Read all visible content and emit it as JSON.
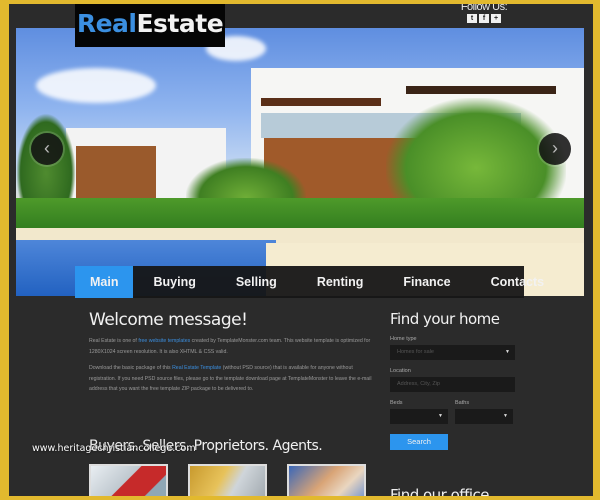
{
  "brand": {
    "part1": "Real",
    "part2": "Estate"
  },
  "social": {
    "label": "Follow Us:",
    "icons": [
      {
        "name": "twitter-icon",
        "glyph": "t"
      },
      {
        "name": "facebook-icon",
        "glyph": "f"
      },
      {
        "name": "plus-icon",
        "glyph": "+"
      }
    ]
  },
  "slider": {
    "prev": "‹",
    "next": "›"
  },
  "nav": {
    "items": [
      {
        "label": "Main",
        "active": true
      },
      {
        "label": "Buying",
        "active": false
      },
      {
        "label": "Selling",
        "active": false
      },
      {
        "label": "Renting",
        "active": false
      },
      {
        "label": "Finance",
        "active": false
      },
      {
        "label": "Contacts",
        "active": false
      }
    ]
  },
  "welcome": {
    "title": "Welcome message!",
    "p1_before": "Real Estate is one of ",
    "p1_link": "free website templates",
    "p1_after": " created by TemplateMonster.com team. This website template is optimized for 1280X1024 screen resolution. It is also XHTML & CSS valid.",
    "p2_before": "Download the basic package of this ",
    "p2_link": "Real Estate Template",
    "p2_after": " (without PSD source) that is available for anyone without registration. If you need PSD source files, please go to the template download page at TemplateMonster to leave the e-mail address that you want the free template ZIP package to be delivered to."
  },
  "section2": {
    "title": "Buyers. Sellers. Proprietors. Agents."
  },
  "watermark": "www.heritagechristiancollege.com",
  "search": {
    "title": "Find your home",
    "home_type_label": "Home type",
    "home_type_value": "Homes for sale",
    "location_label": "Location",
    "location_placeholder": "Address, City, Zip",
    "beds_label": "Beds",
    "baths_label": "Baths",
    "button": "Search"
  },
  "office": {
    "title": "Find our office"
  },
  "colors": {
    "accent": "#2c95ee",
    "frame": "#e2b92e",
    "background": "#2b2b2b"
  }
}
